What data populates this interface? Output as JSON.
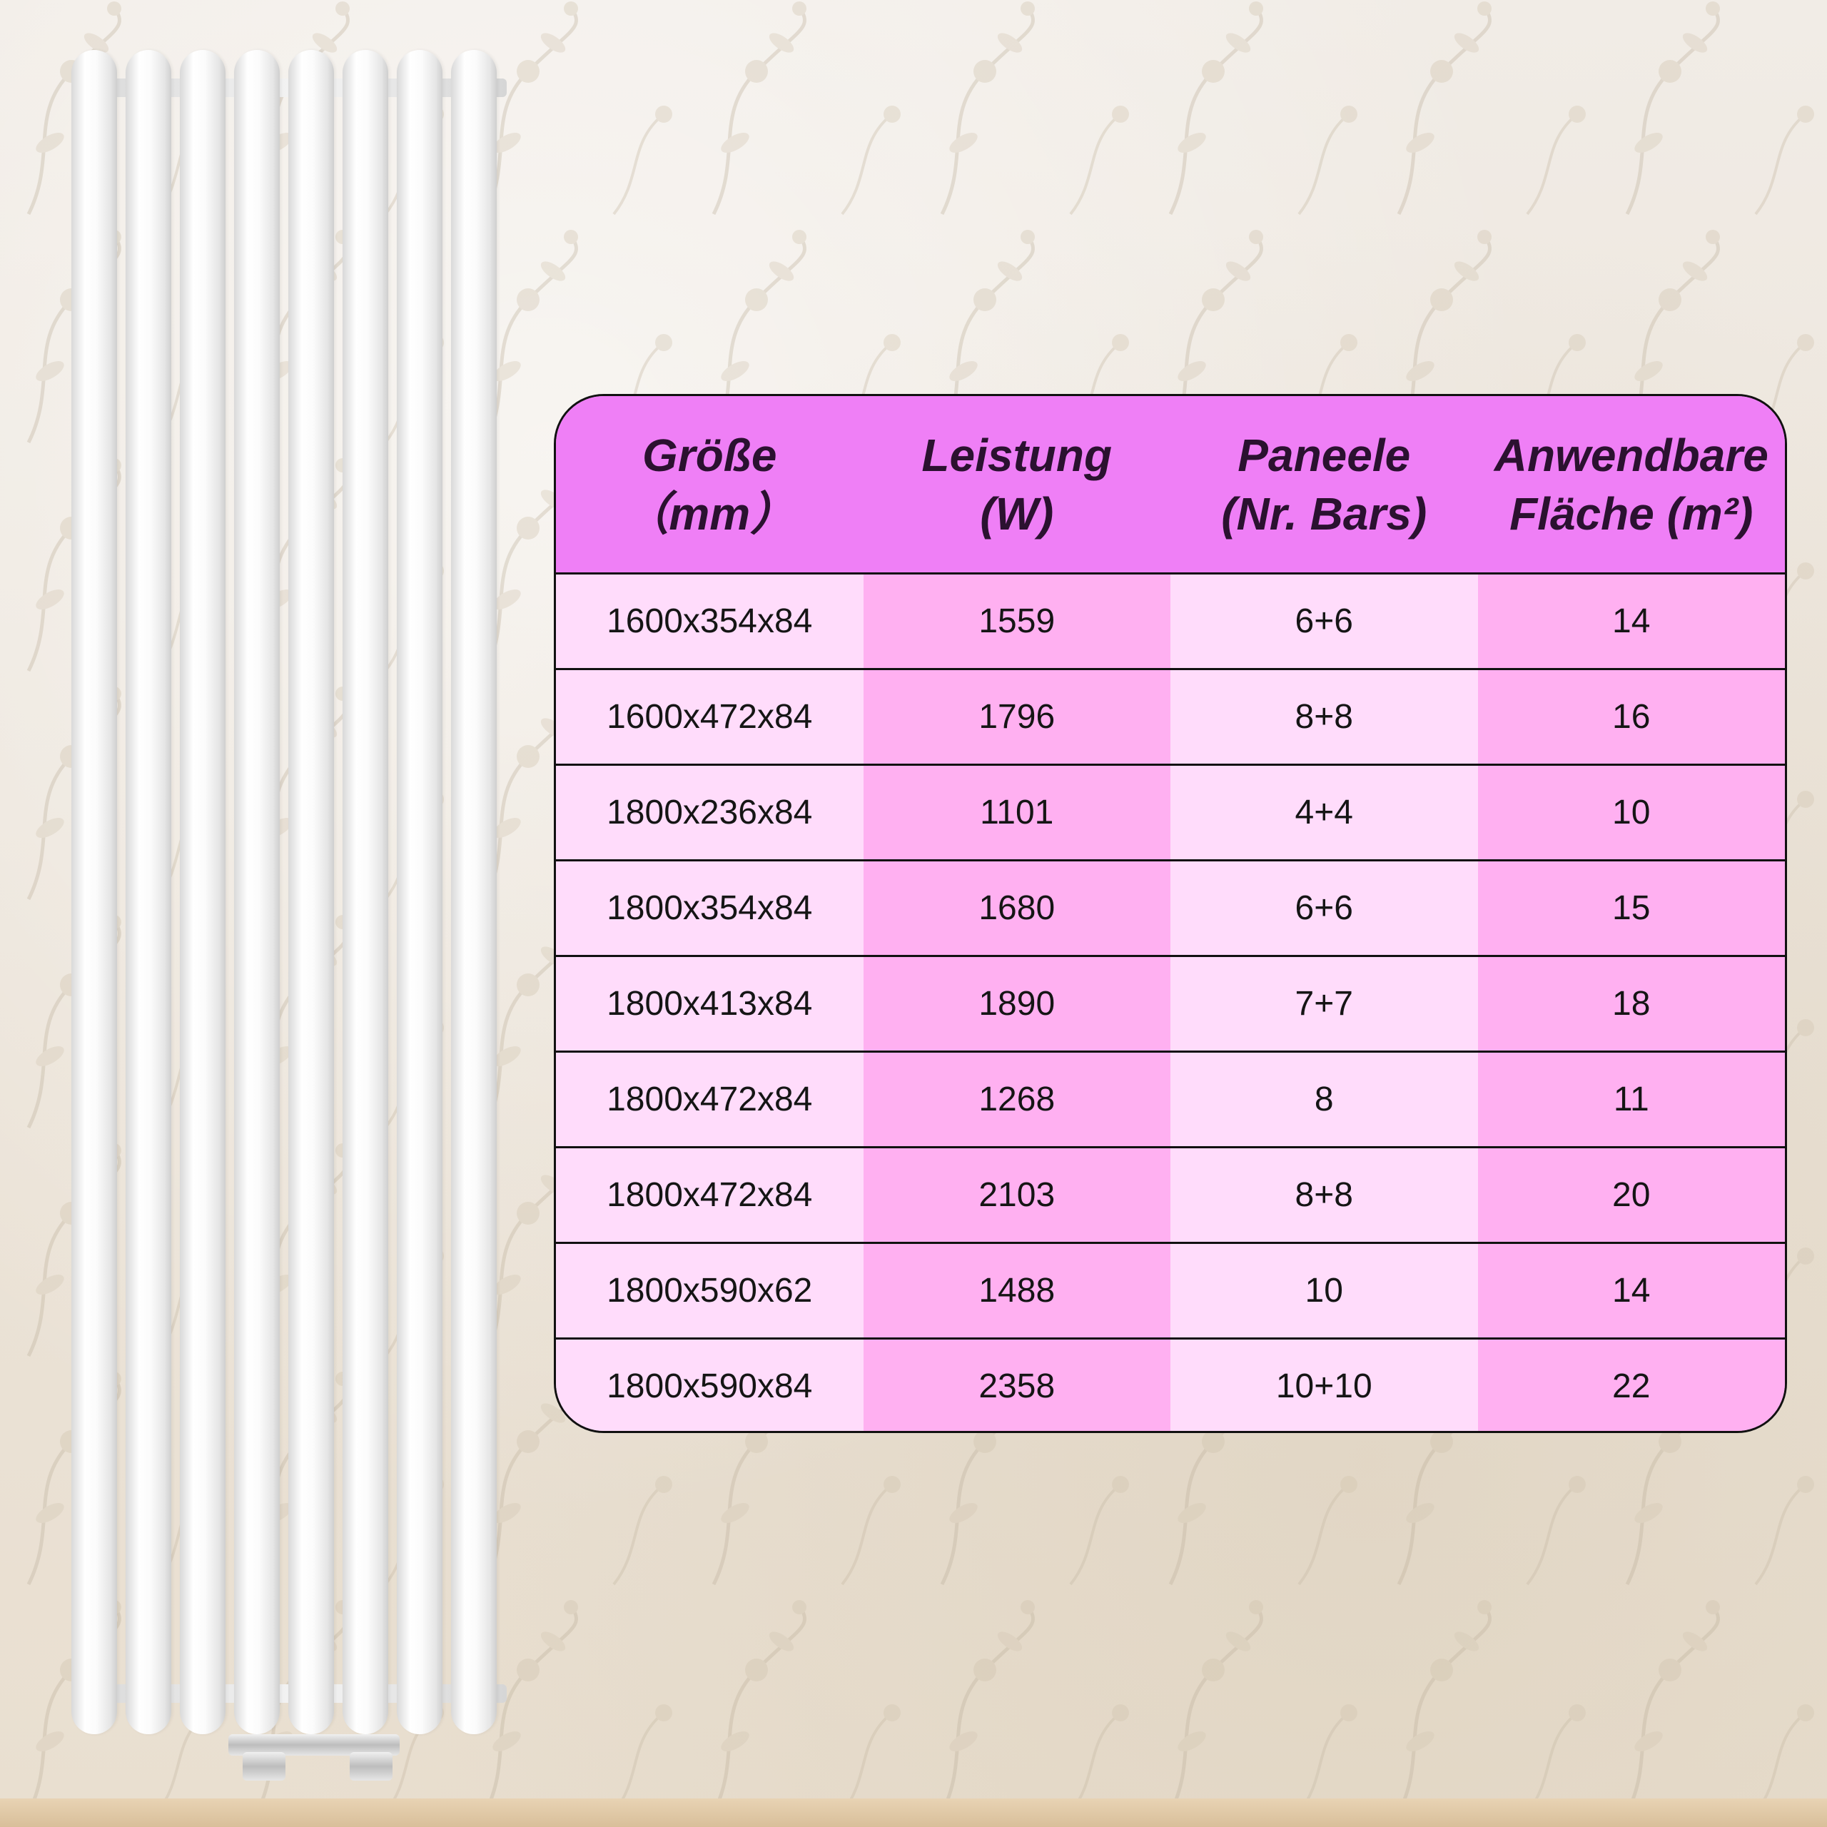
{
  "table": {
    "headers": [
      {
        "line1": "Größe",
        "line2": "（mm）"
      },
      {
        "line1": "Leistung",
        "line2": "(W)"
      },
      {
        "line1": "Paneele",
        "line2": "(Nr. Bars)"
      },
      {
        "line1": "Anwendbare",
        "line2": "Fläche (m²)"
      }
    ],
    "rows": [
      [
        "1600x354x84",
        "1559",
        "6+6",
        "14"
      ],
      [
        "1600x472x84",
        "1796",
        "8+8",
        "16"
      ],
      [
        "1800x236x84",
        "1101",
        "4+4",
        "10"
      ],
      [
        "1800x354x84",
        "1680",
        "6+6",
        "15"
      ],
      [
        "1800x413x84",
        "1890",
        "7+7",
        "18"
      ],
      [
        "1800x472x84",
        "1268",
        "8",
        "11"
      ],
      [
        "1800x472x84",
        "2103",
        "8+8",
        "20"
      ],
      [
        "1800x590x62",
        "1488",
        "10",
        "14"
      ],
      [
        "1800x590x84",
        "2358",
        "10+10",
        "22"
      ]
    ]
  },
  "colors": {
    "header_bg": "#ef7ff6",
    "cell_light": "#ffdcfb",
    "cell_dark": "#ffb0f1",
    "border": "#111111"
  }
}
